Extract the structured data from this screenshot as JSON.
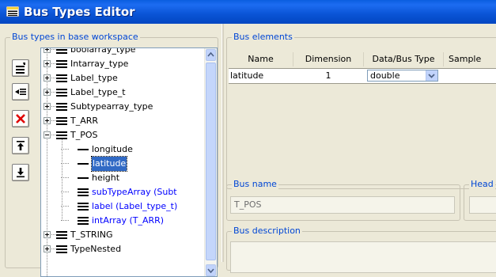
{
  "window": {
    "title": "Bus Types Editor",
    "icon": "bus-editor-icon"
  },
  "left_panel": {
    "legend": "Bus types in base workspace",
    "toolbar": [
      {
        "name": "add-bus-button",
        "icon": "add-bus-icon",
        "tooltip": ""
      },
      {
        "name": "insert-element-button",
        "icon": "insert-element-icon",
        "tooltip": ""
      },
      {
        "name": "delete-button",
        "icon": "delete-x-icon",
        "tooltip": ""
      },
      {
        "name": "move-up-button",
        "icon": "move-up-icon",
        "tooltip": ""
      },
      {
        "name": "move-down-button",
        "icon": "move-down-icon",
        "tooltip": ""
      }
    ],
    "tree": [
      {
        "label": "boolarray_type",
        "kind": "bus",
        "level": 0,
        "expander": "plus",
        "partial": "top"
      },
      {
        "label": "Intarray_type",
        "kind": "bus",
        "level": 0,
        "expander": "plus"
      },
      {
        "label": "Label_type",
        "kind": "bus",
        "level": 0,
        "expander": "plus"
      },
      {
        "label": "Label_type_t",
        "kind": "bus",
        "level": 0,
        "expander": "plus"
      },
      {
        "label": "Subtypearray_type",
        "kind": "bus",
        "level": 0,
        "expander": "plus"
      },
      {
        "label": "T_ARR",
        "kind": "bus",
        "level": 0,
        "expander": "plus"
      },
      {
        "label": "T_POS",
        "kind": "bus",
        "level": 0,
        "expander": "minus"
      },
      {
        "label": "longitude",
        "kind": "element",
        "level": 1
      },
      {
        "label": "latitude",
        "kind": "element",
        "level": 1,
        "selected": true
      },
      {
        "label": "height",
        "kind": "element",
        "level": 1
      },
      {
        "label": "subTypeArray (Subt",
        "kind": "bus-element",
        "level": 1
      },
      {
        "label": "label (Label_type_t)",
        "kind": "bus-element",
        "level": 1
      },
      {
        "label": "intArray (T_ARR)",
        "kind": "bus-element",
        "level": 1
      },
      {
        "label": "T_STRING",
        "kind": "bus",
        "level": 0,
        "expander": "plus"
      },
      {
        "label": "TypeNested",
        "kind": "bus",
        "level": 0,
        "expander": "plus",
        "partial": "bottom"
      }
    ]
  },
  "bus_elements": {
    "legend": "Bus elements",
    "columns": [
      "Name",
      "Dimension",
      "Data/Bus Type",
      "Sample"
    ],
    "rows": [
      {
        "name": "latitude",
        "dimension": "1",
        "data_type": "double",
        "sample": "-"
      }
    ]
  },
  "bus_name": {
    "legend": "Bus name",
    "value": "T_POS"
  },
  "header_file": {
    "legend": "Head"
  },
  "bus_description": {
    "legend": "Bus description",
    "value": ""
  },
  "colors": {
    "title_bar": "#0a54d6",
    "legend_text": "#0046d5",
    "selection": "#316ac5",
    "bus_element_text": "#0000ff",
    "background": "#ece9d8"
  }
}
